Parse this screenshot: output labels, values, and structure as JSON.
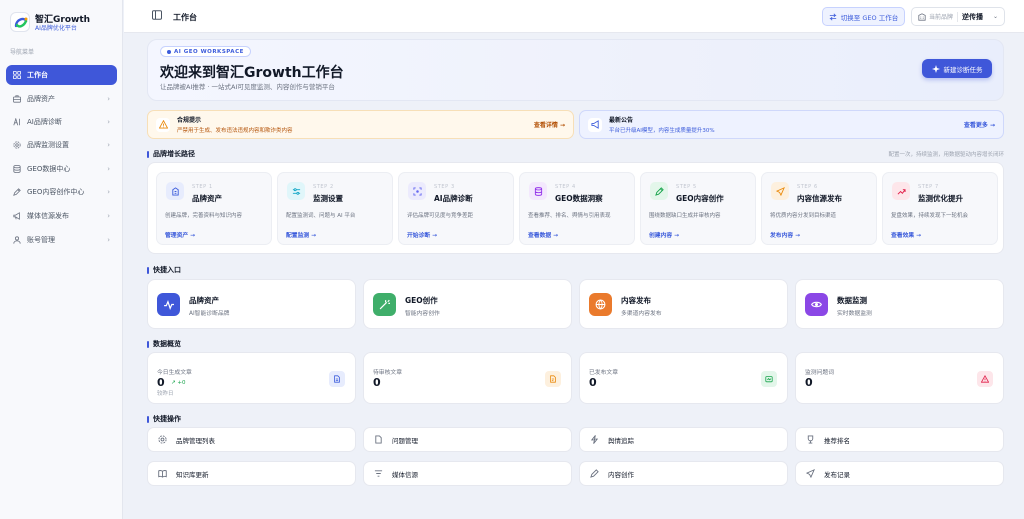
{
  "brand": {
    "name": "智汇Growth",
    "subtitle": "AI品牌优化平台"
  },
  "nav": {
    "heading": "导航菜单",
    "items": [
      {
        "label": "工作台",
        "icon": "grid-icon",
        "active": true
      },
      {
        "label": "品牌资产",
        "icon": "briefcase-icon"
      },
      {
        "label": "AI品牌诊断",
        "icon": "ai-icon"
      },
      {
        "label": "品牌监测设置",
        "icon": "gear-icon"
      },
      {
        "label": "GEO数据中心",
        "icon": "database-icon"
      },
      {
        "label": "GEO内容创作中心",
        "icon": "pen-icon"
      },
      {
        "label": "媒体信源发布",
        "icon": "megaphone-icon"
      },
      {
        "label": "账号管理",
        "icon": "user-icon"
      }
    ]
  },
  "topbar": {
    "title": "工作台",
    "geo_button": "切换至 GEO 工作台",
    "brand_select_label": "当前品牌",
    "brand_select_value": "逆传播"
  },
  "hero": {
    "tag": "AI GEO WORKSPACE",
    "title": "欢迎来到智汇Growth工作台",
    "subtitle": "让品牌被AI推荐 · 一站式AI可见度监测、内容创作与营销平台",
    "button": "新建诊断任务"
  },
  "notices": [
    {
      "title": "合规提示",
      "desc": "严禁用于生成、发布违法违规内容和欺诈类内容",
      "link": "查看详情 →"
    },
    {
      "title": "最新公告",
      "desc": "平台已升级AI模型，内容生成质量提升30%",
      "link": "查看更多 →"
    }
  ],
  "path": {
    "title": "品牌增长路径",
    "note": "配置一次，持续监测，用数据驱动内容增长闭环",
    "steps": [
      {
        "num": "STEP 1",
        "title": "品牌资产",
        "desc": "创建品牌，完善资料与知识内容",
        "link": "管理资产 →",
        "color": "#3b5bdb",
        "bg": "#e7ecfd"
      },
      {
        "num": "STEP 2",
        "title": "监测设置",
        "desc": "配置监测词、问题与 AI 平台",
        "link": "配置监测 →",
        "color": "#0ea5c6",
        "bg": "#e0f6fa"
      },
      {
        "num": "STEP 3",
        "title": "AI品牌诊断",
        "desc": "评估品牌可见度与竞争差距",
        "link": "开始诊断 →",
        "color": "#6366f1",
        "bg": "#ecebfd"
      },
      {
        "num": "STEP 4",
        "title": "GEO数据洞察",
        "desc": "查看推荐、排名、舆情与引用表现",
        "link": "查看数据 →",
        "color": "#9333ea",
        "bg": "#f3e8fd"
      },
      {
        "num": "STEP 5",
        "title": "GEO内容创作",
        "desc": "围绕数据缺口生成并审核内容",
        "link": "创建内容 →",
        "color": "#16a34a",
        "bg": "#e3f6ea"
      },
      {
        "num": "STEP 6",
        "title": "内容信源发布",
        "desc": "将优质内容分发到目标渠道",
        "link": "发布内容 →",
        "color": "#ea8a0c",
        "bg": "#fdf0de"
      },
      {
        "num": "STEP 7",
        "title": "监测优化提升",
        "desc": "复盘效果，持续发现下一轮机会",
        "link": "查看效果 →",
        "color": "#e11d48",
        "bg": "#fde6ea"
      }
    ]
  },
  "quick_entry": {
    "title": "快捷入口",
    "items": [
      {
        "title": "品牌资产",
        "desc": "AI智能诊断品牌",
        "color": "#3f57d9"
      },
      {
        "title": "GEO创作",
        "desc": "智能内容创作",
        "color": "#3fae6a"
      },
      {
        "title": "内容发布",
        "desc": "多渠道内容发布",
        "color": "#ea7a2c"
      },
      {
        "title": "数据监测",
        "desc": "实时数据监测",
        "color": "#8b47e6"
      }
    ]
  },
  "overview": {
    "title": "数据概览",
    "stats": [
      {
        "label": "今日生成文章",
        "value": "0",
        "trend": "↗ +0",
        "compare": "较昨日",
        "color": "#3b5bdb",
        "bg": "#e7ecfd"
      },
      {
        "label": "待审核文章",
        "value": "0",
        "color": "#ea8a0c",
        "bg": "#fdf0de"
      },
      {
        "label": "已发布文章",
        "value": "0",
        "color": "#16a34a",
        "bg": "#e3f6ea"
      },
      {
        "label": "监测问题词",
        "value": "0",
        "color": "#e11d48",
        "bg": "#fde6ea"
      }
    ]
  },
  "operations": {
    "title": "快捷操作",
    "items": [
      {
        "label": "品牌管理列表",
        "icon": "gear-icon"
      },
      {
        "label": "问题管理",
        "icon": "file-icon"
      },
      {
        "label": "舆情追踪",
        "icon": "bolt-icon"
      },
      {
        "label": "推荐排名",
        "icon": "trophy-icon"
      },
      {
        "label": "知识库更新",
        "icon": "book-icon"
      },
      {
        "label": "媒体信源",
        "icon": "filter-icon"
      },
      {
        "label": "内容创作",
        "icon": "pen-icon"
      },
      {
        "label": "发布记录",
        "icon": "send-icon"
      }
    ]
  }
}
